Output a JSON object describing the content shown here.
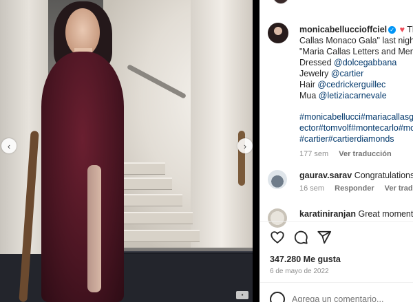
{
  "post": {
    "prev_glyph": "‹",
    "next_glyph": "›",
    "photo_tag": "▪"
  },
  "caption": {
    "username": "monicabelluccioffciel",
    "verified_glyph": "✓",
    "heart": "♥",
    "text_start": "Th",
    "lines": [
      "Callas Monaco Gala\" last night,",
      "\"Maria Callas Letters and Memo"
    ],
    "dressed_label": "Dressed ",
    "dressed_link": "@dolcegabbana",
    "jewelry_label": "Jewelry ",
    "jewelry_link": "@cartier",
    "hair_label": "Hair ",
    "hair_link": "@cedrickerguillec",
    "mua_label": "Mua ",
    "mua_link": "@letiziacarnevale",
    "hashtags": [
      "#monicabellucci#mariacallasga",
      "ector#tomvolf#montecarlo#mo",
      "#cartier#cartierdiamonds"
    ],
    "time": "177 sem",
    "translate": "Ver traducción"
  },
  "comments": [
    {
      "username": "gaurav.sarav",
      "text": "Congratulations",
      "time": "16 sem",
      "reply": "Responder",
      "translate": "Ver traducción"
    },
    {
      "username": "karatiniranjan",
      "text": "Great moments"
    }
  ],
  "engagement": {
    "likes": "347.280 Me gusta",
    "date": "6 de mayo de 2022"
  },
  "add_comment": {
    "placeholder": "Agrega un comentario..."
  }
}
